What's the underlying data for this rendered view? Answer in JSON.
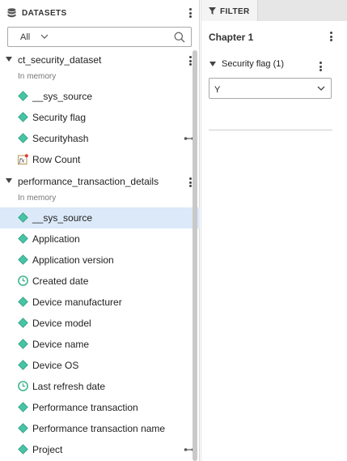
{
  "datasets_panel": {
    "title": "DATASETS",
    "search": {
      "scope_value": "All"
    },
    "datasets": [
      {
        "name": "ct_security_dataset",
        "status": "In memory",
        "items": [
          {
            "label": "__sys_source",
            "icon": "attribute-diamond-icon",
            "selected": false
          },
          {
            "label": "Security flag",
            "icon": "attribute-diamond-icon",
            "selected": false
          },
          {
            "label": "Securityhash",
            "icon": "attribute-diamond-icon",
            "selected": false,
            "linked": true
          },
          {
            "label": "Row Count",
            "icon": "fx-metric-icon",
            "selected": false
          }
        ]
      },
      {
        "name": "performance_transaction_details",
        "status": "In memory",
        "items": [
          {
            "label": "__sys_source",
            "icon": "attribute-diamond-icon",
            "selected": true
          },
          {
            "label": "Application",
            "icon": "attribute-diamond-icon",
            "selected": false
          },
          {
            "label": "Application version",
            "icon": "attribute-diamond-icon",
            "selected": false
          },
          {
            "label": "Created date",
            "icon": "date-clock-icon",
            "selected": false
          },
          {
            "label": "Device manufacturer",
            "icon": "attribute-diamond-icon",
            "selected": false
          },
          {
            "label": "Device model",
            "icon": "attribute-diamond-icon",
            "selected": false
          },
          {
            "label": "Device name",
            "icon": "attribute-diamond-icon",
            "selected": false
          },
          {
            "label": "Device OS",
            "icon": "attribute-diamond-icon",
            "selected": false
          },
          {
            "label": "Last refresh date",
            "icon": "date-clock-icon",
            "selected": false
          },
          {
            "label": "Performance transaction",
            "icon": "attribute-diamond-icon",
            "selected": false
          },
          {
            "label": "Performance transaction name",
            "icon": "attribute-diamond-icon",
            "selected": false
          },
          {
            "label": "Project",
            "icon": "attribute-diamond-icon",
            "selected": false,
            "linked": true
          }
        ]
      }
    ]
  },
  "filter_panel": {
    "tab_label": "FILTER",
    "chapter_title": "Chapter 1",
    "filter": {
      "label": "Security flag (1)",
      "selected_value": "Y"
    }
  },
  "colors": {
    "attribute_icon": "#47c4a4",
    "date_icon": "#2fae84",
    "metric_icon_dot": "#e53935",
    "selection": "#dbe9f8"
  }
}
